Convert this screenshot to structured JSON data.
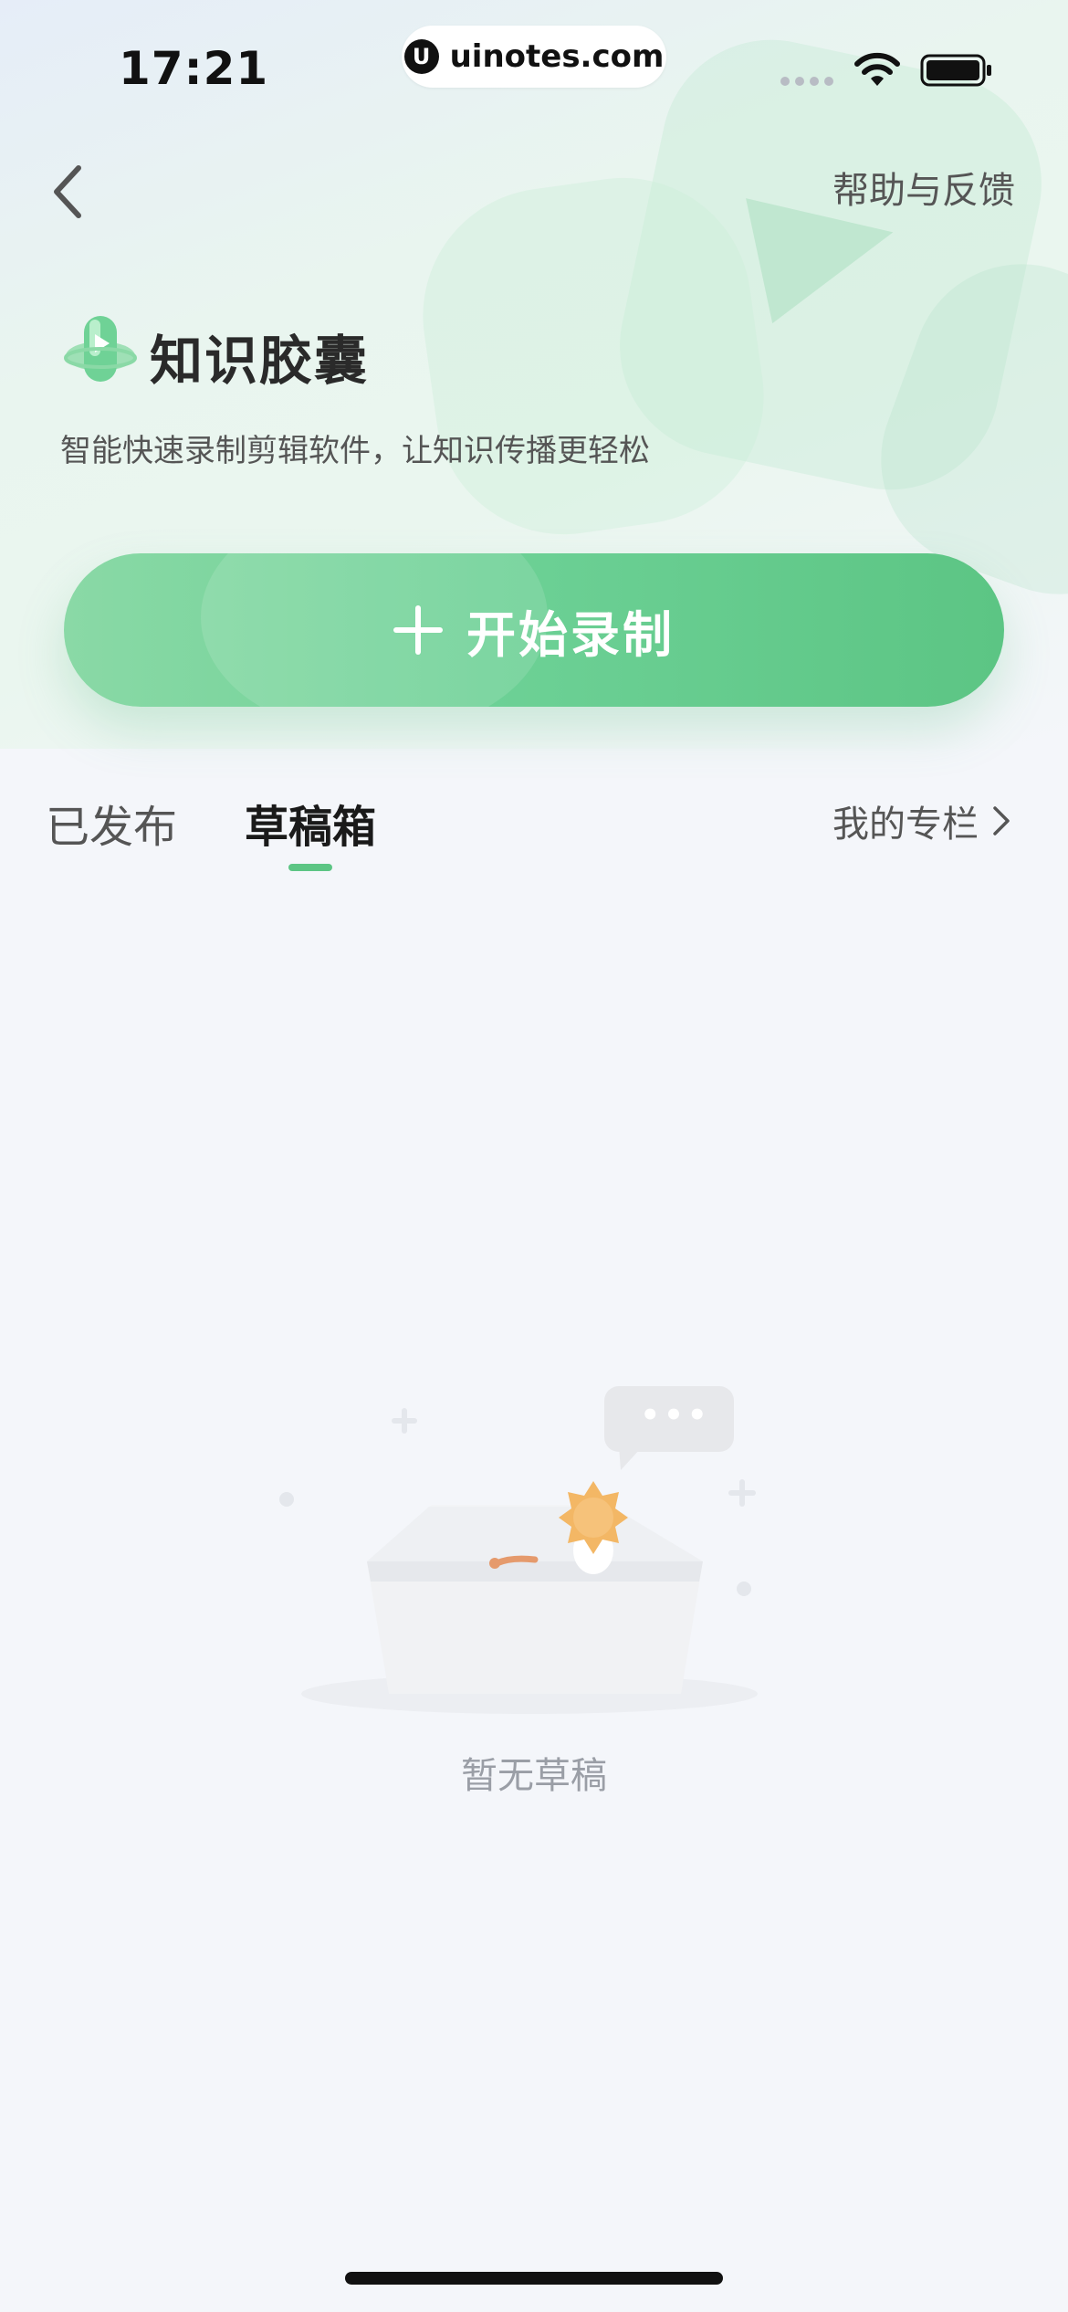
{
  "status_bar": {
    "time": "17:21",
    "url_badge_icon": "U",
    "url": "uinotes.com"
  },
  "nav": {
    "back_icon": "chevron-left-icon",
    "help_label": "帮助与反馈"
  },
  "brand": {
    "title": "知识胶囊",
    "subtitle": "智能快速录制剪辑软件，让知识传播更轻松"
  },
  "record_button": {
    "label": "开始录制",
    "icon": "plus-icon"
  },
  "tabs": [
    {
      "label": "已发布",
      "active": false
    },
    {
      "label": "草稿箱",
      "active": true
    }
  ],
  "my_column": {
    "label": "我的专栏",
    "icon": "chevron-right-icon"
  },
  "empty_state": {
    "text": "暂无草稿",
    "bubble_text": "•••"
  },
  "colors": {
    "accent": "#5cc584",
    "button_gradient_start": "#8ad9a6",
    "button_gradient_end": "#5cc584",
    "background": "#f4f6fa"
  }
}
